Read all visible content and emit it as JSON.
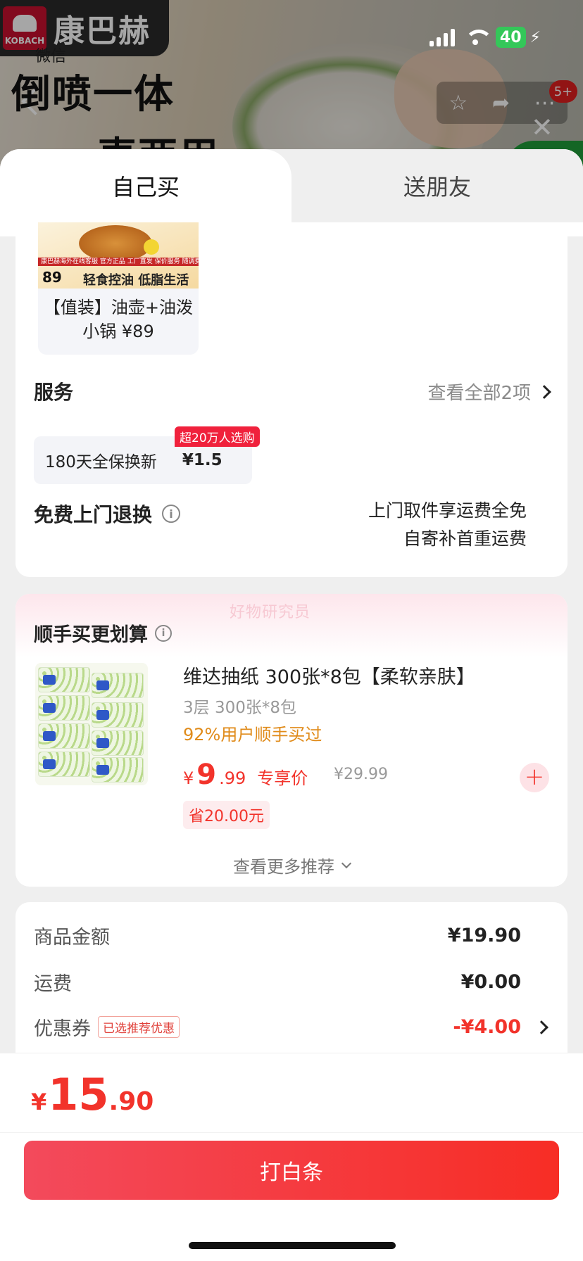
{
  "status_bar": {
    "battery": "40"
  },
  "background": {
    "brand_logo": "KOBACH",
    "brand_name": "康巴赫",
    "back_label": "微信",
    "headline_line1": "倒喷一体",
    "headline_line2": "一壶两用",
    "more_badge": "5+"
  },
  "tabs": [
    {
      "label": "自己买"
    },
    {
      "label": "送朋友"
    }
  ],
  "bundle": {
    "strip_text": "康巴赫海外在线客服  官方正品 工厂直发 保价服务 随调费用",
    "mini_price": "89",
    "slogan": "轻食控油 低脂生活",
    "name": "【值装】油壶+油泼小锅 ¥89"
  },
  "service": {
    "title": "服务",
    "more_label": "查看全部2项",
    "chip_label": "180天全保换新",
    "chip_price": "¥1.5",
    "chip_tag": "超20万人选购"
  },
  "return": {
    "title": "免费上门退换",
    "desc_line1": "上门取件享运费全免",
    "desc_line2": "自寄补首重运费"
  },
  "addon": {
    "watermark": "好物研究员",
    "title": "顺手买更划算",
    "product": {
      "name": "维达抽纸 300张*8包【柔软亲肤】",
      "spec": "3层 300张*8包",
      "hint": "92%用户顺手买过",
      "currency": "¥",
      "price_int": "9",
      "price_dec": ".99",
      "price_tag": "专享价",
      "original_price": "¥29.99",
      "save": "省20.00元"
    },
    "more_label": "查看更多推荐"
  },
  "summary": {
    "goods_label": "商品金额",
    "goods_value": "¥19.90",
    "shipping_label": "运费",
    "shipping_value": "¥0.00",
    "coupon_label": "优惠券",
    "coupon_tag": "已选推荐优惠",
    "coupon_value": "-¥4.00"
  },
  "checkout": {
    "currency": "¥",
    "total_int": "15",
    "total_dec": ".90",
    "pay_label": "打白条"
  },
  "colors": {
    "accent_red": "#f2332b",
    "pay_gradient_start": "#f34a5c",
    "pay_gradient_end": "#f72d25",
    "hint_orange": "#e08b1a"
  }
}
